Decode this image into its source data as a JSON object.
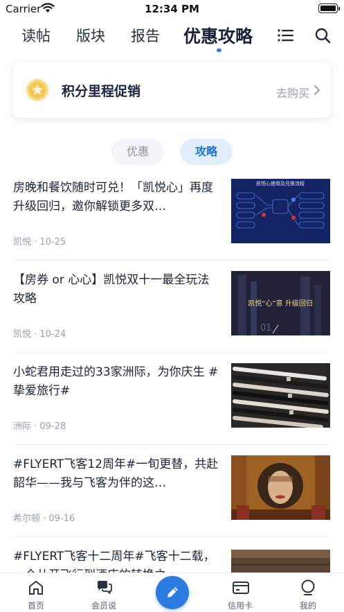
{
  "status_bar": {
    "carrier": "Carrier",
    "time": "12:34 PM"
  },
  "top_nav": {
    "tabs": [
      {
        "label": "读帖"
      },
      {
        "label": "版块"
      },
      {
        "label": "报告"
      },
      {
        "label": "优惠攻略",
        "active": true
      }
    ],
    "icons": [
      "menu-list-icon",
      "search-icon"
    ],
    "accent": "#2b7be0"
  },
  "promo": {
    "title": "积分里程促销",
    "link": "去购买"
  },
  "filters": {
    "deals": "优惠",
    "guides": "攻略",
    "selected": "攻略"
  },
  "articles": [
    {
      "title": "房晚和餐饮随时可兑！「凯悦心」再度升级回归，邀你解锁更多双…",
      "meta": "凯悦 · 10-25",
      "thumb": "infographic"
    },
    {
      "title": "【房券 or 心心】凯悦双十一最全玩法攻略",
      "meta": "凯悦 · 10-24",
      "thumb": "city-night"
    },
    {
      "title": "小蛇君用走过的33家洲际，为你庆生 #挚爱旅行#",
      "meta": "洲际 · 09-28",
      "thumb": "pens"
    },
    {
      "title": "#FLYERT飞客12周年#一旬更替，共赴韶华——我与飞客为伴的这…",
      "meta": "希尔顿 · 09-16",
      "thumb": "hotel-art"
    },
    {
      "title": "#FLYERT飞客十二周年#飞客十二载，一个从开飞行到酒店的转换之…",
      "meta": "",
      "thumb": "wood"
    }
  ],
  "thumb_texts": {
    "infographic": "凯悦心使用及兑换流程",
    "city_night": "凯悦“心”意 升级回归"
  },
  "tab_bar": {
    "items": [
      {
        "label": "首页",
        "icon": "home-icon"
      },
      {
        "label": "会员说",
        "icon": "chat-bubbles-icon"
      },
      {
        "label": "",
        "icon": "pencil-icon"
      },
      {
        "label": "信用卡",
        "icon": "credit-card-icon"
      },
      {
        "label": "我的",
        "icon": "profile-icon"
      }
    ]
  }
}
